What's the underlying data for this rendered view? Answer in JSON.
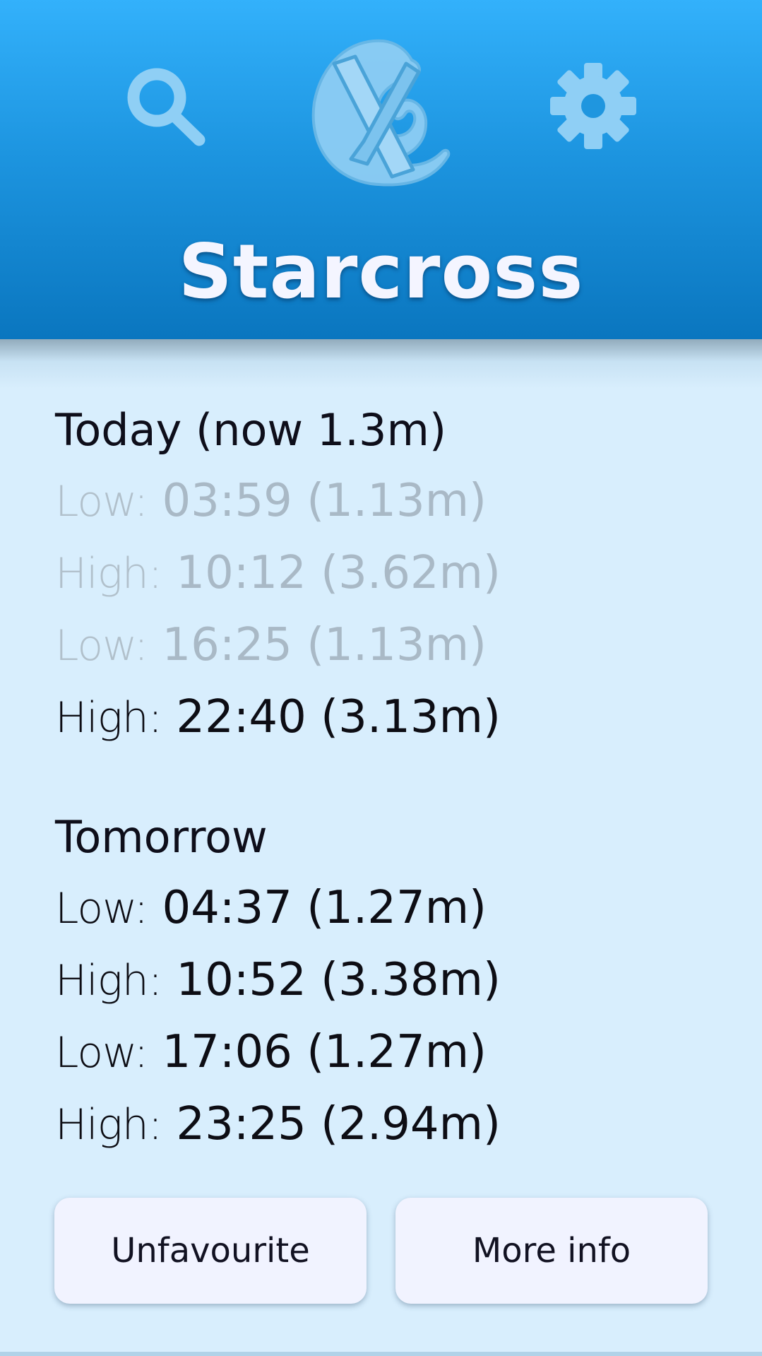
{
  "header": {
    "title": "Starcross",
    "search_icon": "search-icon",
    "settings_icon": "gear-icon",
    "logo_icon": "app-logo-icon",
    "gradient_top": "#33b1fb",
    "gradient_bottom": "#0a76bf"
  },
  "today": {
    "heading": "Today (now 1.3m)",
    "tides": [
      {
        "label": "Low:",
        "value": "03:59 (1.13m)",
        "past": true
      },
      {
        "label": "High:",
        "value": "10:12 (3.62m)",
        "past": true
      },
      {
        "label": "Low:",
        "value": "16:25 (1.13m)",
        "past": true
      },
      {
        "label": "High:",
        "value": "22:40 (3.13m)",
        "past": false
      }
    ]
  },
  "tomorrow": {
    "heading": "Tomorrow",
    "tides": [
      {
        "label": "Low:",
        "value": "04:37 (1.27m)"
      },
      {
        "label": "High:",
        "value": "10:52 (3.38m)"
      },
      {
        "label": "Low:",
        "value": "17:06 (1.27m)"
      },
      {
        "label": "High:",
        "value": "23:25 (2.94m)"
      }
    ]
  },
  "actions": {
    "unfavourite_label": "Unfavourite",
    "more_info_label": "More info"
  },
  "colors": {
    "background": "#d8eefd",
    "past_text": "#a9b9c6",
    "button_bg": "#f1f3ff"
  }
}
